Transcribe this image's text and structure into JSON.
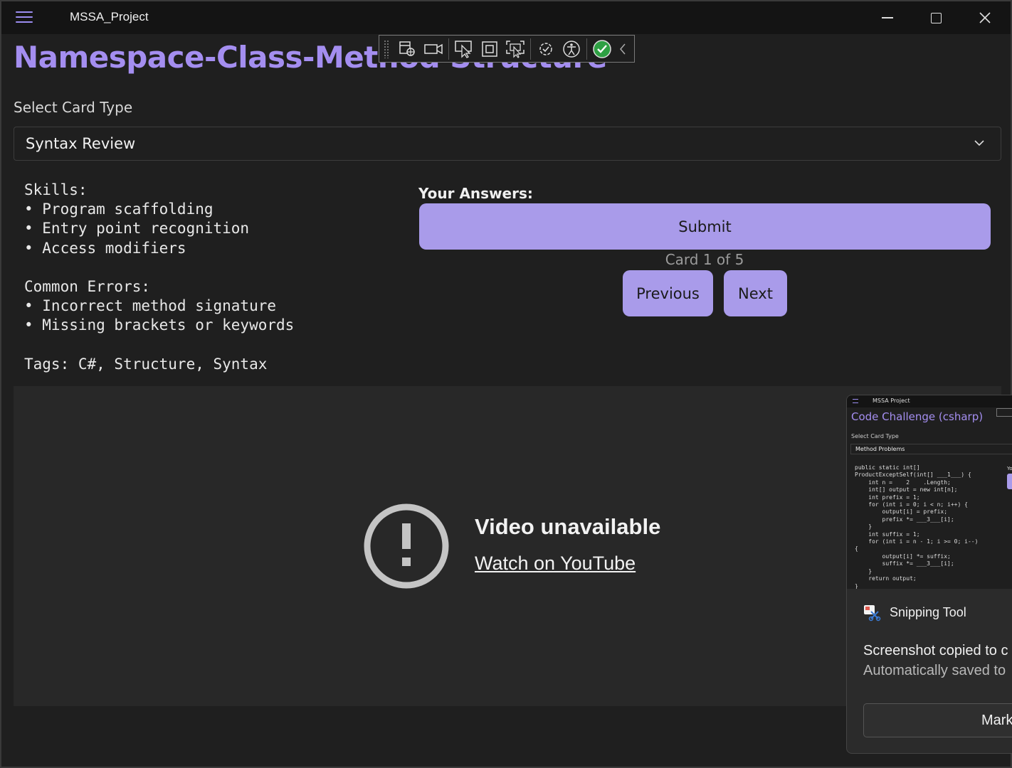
{
  "window": {
    "title": "MSSA_Project"
  },
  "page": {
    "heading": "Namespace-Class-Method Structure",
    "select_label": "Select Card Type",
    "select_value": "Syntax Review"
  },
  "card": {
    "text": "Skills:\n• Program scaffolding\n• Entry point recognition\n• Access modifiers\n\nCommon Errors:\n• Incorrect method signature\n• Missing brackets or keywords\n\nTags: C#, Structure, Syntax"
  },
  "answers": {
    "label": "Your Answers:",
    "submit_label": "Submit",
    "counter": "Card 1 of 5",
    "previous_label": "Previous",
    "next_label": "Next"
  },
  "video": {
    "title": "Video unavailable",
    "link": "Watch on YouTube"
  },
  "toast": {
    "thumbnail": {
      "app_title": "MSSA Project",
      "heading": "Code Challenge (csharp)",
      "select_label": "Select Card Type",
      "select_value": "Method Problems",
      "answers_partial": "Yo",
      "code": "public static int[]\nProductExceptSelf(int[] ___1___) {\n    int n =    2    .Length;\n    int[] output = new int[n];\n    int prefix = 1;\n    for (int i = 0; i < n; i++) {\n        output[i] = prefix;\n        prefix *= ___3___[i];\n    }\n    int suffix = 1;\n    for (int i = n - 1; i >= 0; i--)\n{\n        output[i] *= suffix;\n        suffix *= ___3___[i];\n    }\n    return output;\n}"
    },
    "app_name": "Snipping Tool",
    "message": "Screenshot copied to c",
    "submessage": "Automatically saved to",
    "button_label": "Mark"
  },
  "colors": {
    "accent": "#a48ef0",
    "button": "#a99bea",
    "background": "#1f1f1f",
    "titlebar": "#141414"
  },
  "icons": {
    "menu": "hamburger-menu-icon",
    "minimize": "minimize-icon",
    "maximize": "maximize-icon",
    "close": "close-icon",
    "dropdown": "chevron-down-icon",
    "video_error": "exclamation-circle-icon",
    "snipping_tool": "snipping-tool-icon"
  }
}
